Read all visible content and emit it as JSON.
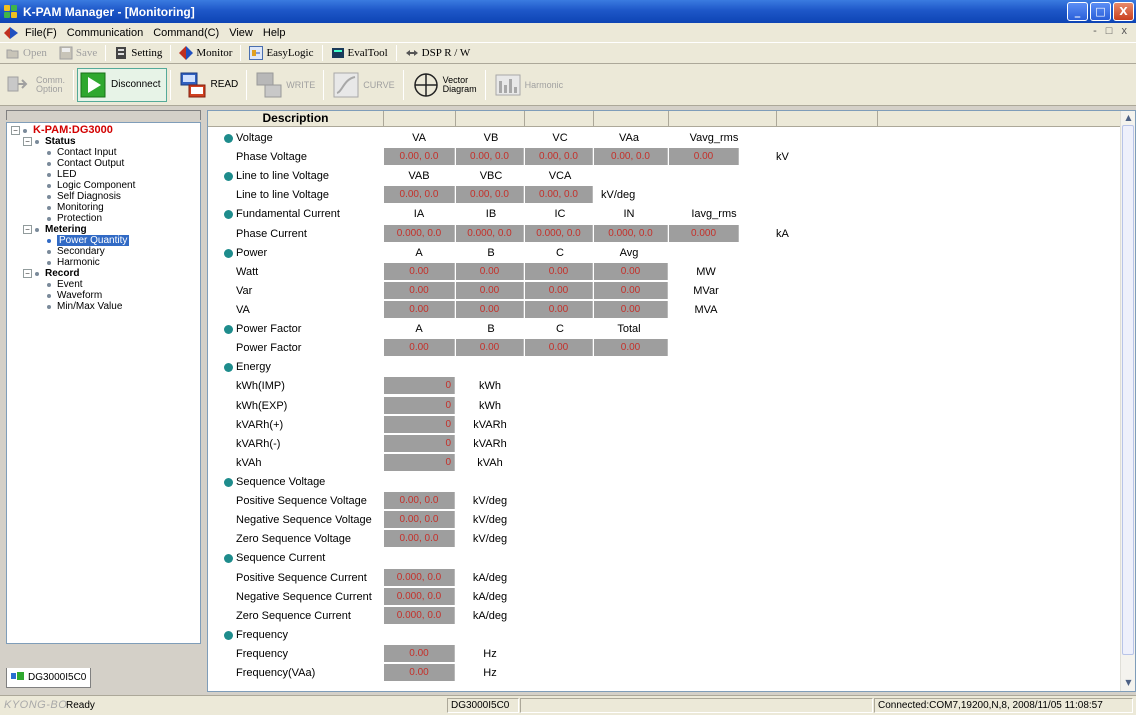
{
  "window": {
    "title": "K-PAM Manager - [Monitoring]",
    "controls": [
      "_",
      "□",
      "X"
    ]
  },
  "menu": {
    "items": [
      "File(F)",
      "Communication",
      "Command(C)",
      "View",
      "Help"
    ],
    "mdi_controls": "- □ x"
  },
  "toolbar1": {
    "open": "Open",
    "save": "Save",
    "setting": "Setting",
    "monitor": "Monitor",
    "easylogic": "EasyLogic",
    "evaltool": "EvalTool",
    "dsp": "DSP R / W"
  },
  "toolbar2": {
    "comm_option_1": "Comm.",
    "comm_option_2": "Option",
    "disconnect": "Disconnect",
    "read": "READ",
    "write": "WRITE",
    "curve": "CURVE",
    "vector_1": "Vector",
    "vector_2": "Diagram",
    "harmonic": "Harmonic"
  },
  "tree": {
    "root": "K-PAM:DG3000",
    "status": {
      "label": "Status",
      "children": [
        "Contact Input",
        "Contact Output",
        "LED",
        "Logic Component",
        "Self Diagnosis",
        "Monitoring",
        "Protection"
      ]
    },
    "metering": {
      "label": "Metering",
      "children": [
        "Power Quantity",
        "Secondary",
        "Harmonic"
      ]
    },
    "record": {
      "label": "Record",
      "children": [
        "Event",
        "Waveform",
        "Min/Max Value"
      ]
    },
    "device_tab": "DG3000I5C0"
  },
  "grid": {
    "header": "Description",
    "voltage": {
      "title": "Voltage",
      "cols": [
        "VA",
        "VB",
        "VC",
        "VAa",
        "Vavg_rms"
      ],
      "row_label": "Phase Voltage",
      "values": [
        "0.00, 0.0",
        "0.00, 0.0",
        "0.00, 0.0",
        "0.00, 0.0",
        "0.00"
      ],
      "unit": "kV"
    },
    "line_voltage": {
      "title": "Line to line Voltage",
      "cols": [
        "VAB",
        "VBC",
        "VCA"
      ],
      "row_label": "Line to line Voltage",
      "values": [
        "0.00, 0.0",
        "0.00, 0.0",
        "0.00, 0.0"
      ],
      "unit": "kV/deg"
    },
    "fund_current": {
      "title": "Fundamental Current",
      "cols": [
        "IA",
        "IB",
        "IC",
        "IN",
        "Iavg_rms"
      ],
      "row_label": "Phase Current",
      "values": [
        "0.000, 0.0",
        "0.000, 0.0",
        "0.000, 0.0",
        "0.000, 0.0",
        "0.000"
      ],
      "unit": "kA"
    },
    "power": {
      "title": "Power",
      "cols": [
        "A",
        "B",
        "C",
        "Avg"
      ],
      "rows": [
        {
          "label": "Watt",
          "values": [
            "0.00",
            "0.00",
            "0.00",
            "0.00"
          ],
          "unit": "MW"
        },
        {
          "label": "Var",
          "values": [
            "0.00",
            "0.00",
            "0.00",
            "0.00"
          ],
          "unit": "MVar"
        },
        {
          "label": "VA",
          "values": [
            "0.00",
            "0.00",
            "0.00",
            "0.00"
          ],
          "unit": "MVA"
        }
      ]
    },
    "power_factor": {
      "title": "Power Factor",
      "cols": [
        "A",
        "B",
        "C",
        "Total"
      ],
      "row_label": "Power Factor",
      "values": [
        "0.00",
        "0.00",
        "0.00",
        "0.00"
      ]
    },
    "energy": {
      "title": "Energy",
      "rows": [
        {
          "label": "kWh(IMP)",
          "value": "0",
          "unit": "kWh"
        },
        {
          "label": "kWh(EXP)",
          "value": "0",
          "unit": "kWh"
        },
        {
          "label": "kVARh(+)",
          "value": "0",
          "unit": "kVARh"
        },
        {
          "label": "kVARh(-)",
          "value": "0",
          "unit": "kVARh"
        },
        {
          "label": "kVAh",
          "value": "0",
          "unit": "kVAh"
        }
      ]
    },
    "seq_voltage": {
      "title": "Sequence Voltage",
      "rows": [
        {
          "label": "Positive Sequence Voltage",
          "value": "0.00, 0.0",
          "unit": "kV/deg"
        },
        {
          "label": "Negative Sequence Voltage",
          "value": "0.00, 0.0",
          "unit": "kV/deg"
        },
        {
          "label": "Zero Sequence Voltage",
          "value": "0.00, 0.0",
          "unit": "kV/deg"
        }
      ]
    },
    "seq_current": {
      "title": "Sequence Current",
      "rows": [
        {
          "label": "Positive Sequence Current",
          "value": "0.000, 0.0",
          "unit": "kA/deg"
        },
        {
          "label": "Negative Sequence Current",
          "value": "0.000, 0.0",
          "unit": "kA/deg"
        },
        {
          "label": "Zero Sequence Current",
          "value": "0.000, 0.0",
          "unit": "kA/deg"
        }
      ]
    },
    "frequency": {
      "title": "Frequency",
      "rows": [
        {
          "label": "Frequency",
          "value": "0.00",
          "unit": "Hz"
        },
        {
          "label": "Frequency(VAa)",
          "value": "0.00",
          "unit": "Hz"
        }
      ]
    }
  },
  "status": {
    "brand": "KYONG-BO",
    "ready": "Ready",
    "device": "DG3000I5C0",
    "connection": "Connected:COM7,19200,N,8,  2008/11/05 11:08:57"
  },
  "colors": {
    "title_bar": "#1e57c8",
    "value_cell": "#9e9e9e",
    "value_text": "#c4302a",
    "bullet": "#1e8c8c",
    "root_text": "#d20000",
    "selection": "#316ac5"
  }
}
